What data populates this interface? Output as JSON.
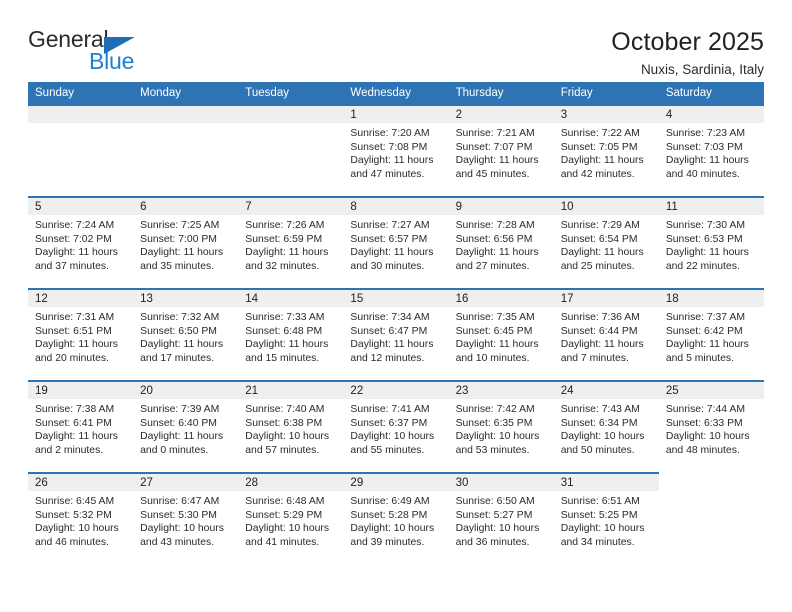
{
  "logo": {
    "word1": "General",
    "word2": "Blue",
    "triangle_color": "#1f6db5",
    "word2_color": "#1f7fd0"
  },
  "header": {
    "title": "October 2025",
    "subtitle": "Nuxis, Sardinia, Italy"
  },
  "theme": {
    "header_bg": "#2e74b5",
    "header_text": "#ffffff",
    "daynum_bg": "#efefef",
    "row_rule": "#2e74b5"
  },
  "calendar": {
    "weekday_headers": [
      "Sunday",
      "Monday",
      "Tuesday",
      "Wednesday",
      "Thursday",
      "Friday",
      "Saturday"
    ],
    "labels": {
      "sunrise": "Sunrise:",
      "sunset": "Sunset:",
      "daylight": "Daylight:"
    },
    "weeks": [
      [
        {
          "day": "",
          "empty": true,
          "band": true
        },
        {
          "day": "",
          "empty": true,
          "band": true
        },
        {
          "day": "",
          "empty": true,
          "band": true
        },
        {
          "day": "1",
          "sunrise": "Sunrise: 7:20 AM",
          "sunset": "Sunset: 7:08 PM",
          "daylight1": "Daylight: 11 hours",
          "daylight2": "and 47 minutes."
        },
        {
          "day": "2",
          "sunrise": "Sunrise: 7:21 AM",
          "sunset": "Sunset: 7:07 PM",
          "daylight1": "Daylight: 11 hours",
          "daylight2": "and 45 minutes."
        },
        {
          "day": "3",
          "sunrise": "Sunrise: 7:22 AM",
          "sunset": "Sunset: 7:05 PM",
          "daylight1": "Daylight: 11 hours",
          "daylight2": "and 42 minutes."
        },
        {
          "day": "4",
          "sunrise": "Sunrise: 7:23 AM",
          "sunset": "Sunset: 7:03 PM",
          "daylight1": "Daylight: 11 hours",
          "daylight2": "and 40 minutes."
        }
      ],
      [
        {
          "day": "5",
          "sunrise": "Sunrise: 7:24 AM",
          "sunset": "Sunset: 7:02 PM",
          "daylight1": "Daylight: 11 hours",
          "daylight2": "and 37 minutes."
        },
        {
          "day": "6",
          "sunrise": "Sunrise: 7:25 AM",
          "sunset": "Sunset: 7:00 PM",
          "daylight1": "Daylight: 11 hours",
          "daylight2": "and 35 minutes."
        },
        {
          "day": "7",
          "sunrise": "Sunrise: 7:26 AM",
          "sunset": "Sunset: 6:59 PM",
          "daylight1": "Daylight: 11 hours",
          "daylight2": "and 32 minutes."
        },
        {
          "day": "8",
          "sunrise": "Sunrise: 7:27 AM",
          "sunset": "Sunset: 6:57 PM",
          "daylight1": "Daylight: 11 hours",
          "daylight2": "and 30 minutes."
        },
        {
          "day": "9",
          "sunrise": "Sunrise: 7:28 AM",
          "sunset": "Sunset: 6:56 PM",
          "daylight1": "Daylight: 11 hours",
          "daylight2": "and 27 minutes."
        },
        {
          "day": "10",
          "sunrise": "Sunrise: 7:29 AM",
          "sunset": "Sunset: 6:54 PM",
          "daylight1": "Daylight: 11 hours",
          "daylight2": "and 25 minutes."
        },
        {
          "day": "11",
          "sunrise": "Sunrise: 7:30 AM",
          "sunset": "Sunset: 6:53 PM",
          "daylight1": "Daylight: 11 hours",
          "daylight2": "and 22 minutes."
        }
      ],
      [
        {
          "day": "12",
          "sunrise": "Sunrise: 7:31 AM",
          "sunset": "Sunset: 6:51 PM",
          "daylight1": "Daylight: 11 hours",
          "daylight2": "and 20 minutes."
        },
        {
          "day": "13",
          "sunrise": "Sunrise: 7:32 AM",
          "sunset": "Sunset: 6:50 PM",
          "daylight1": "Daylight: 11 hours",
          "daylight2": "and 17 minutes."
        },
        {
          "day": "14",
          "sunrise": "Sunrise: 7:33 AM",
          "sunset": "Sunset: 6:48 PM",
          "daylight1": "Daylight: 11 hours",
          "daylight2": "and 15 minutes."
        },
        {
          "day": "15",
          "sunrise": "Sunrise: 7:34 AM",
          "sunset": "Sunset: 6:47 PM",
          "daylight1": "Daylight: 11 hours",
          "daylight2": "and 12 minutes."
        },
        {
          "day": "16",
          "sunrise": "Sunrise: 7:35 AM",
          "sunset": "Sunset: 6:45 PM",
          "daylight1": "Daylight: 11 hours",
          "daylight2": "and 10 minutes."
        },
        {
          "day": "17",
          "sunrise": "Sunrise: 7:36 AM",
          "sunset": "Sunset: 6:44 PM",
          "daylight1": "Daylight: 11 hours",
          "daylight2": "and 7 minutes."
        },
        {
          "day": "18",
          "sunrise": "Sunrise: 7:37 AM",
          "sunset": "Sunset: 6:42 PM",
          "daylight1": "Daylight: 11 hours",
          "daylight2": "and 5 minutes."
        }
      ],
      [
        {
          "day": "19",
          "sunrise": "Sunrise: 7:38 AM",
          "sunset": "Sunset: 6:41 PM",
          "daylight1": "Daylight: 11 hours",
          "daylight2": "and 2 minutes."
        },
        {
          "day": "20",
          "sunrise": "Sunrise: 7:39 AM",
          "sunset": "Sunset: 6:40 PM",
          "daylight1": "Daylight: 11 hours",
          "daylight2": "and 0 minutes."
        },
        {
          "day": "21",
          "sunrise": "Sunrise: 7:40 AM",
          "sunset": "Sunset: 6:38 PM",
          "daylight1": "Daylight: 10 hours",
          "daylight2": "and 57 minutes."
        },
        {
          "day": "22",
          "sunrise": "Sunrise: 7:41 AM",
          "sunset": "Sunset: 6:37 PM",
          "daylight1": "Daylight: 10 hours",
          "daylight2": "and 55 minutes."
        },
        {
          "day": "23",
          "sunrise": "Sunrise: 7:42 AM",
          "sunset": "Sunset: 6:35 PM",
          "daylight1": "Daylight: 10 hours",
          "daylight2": "and 53 minutes."
        },
        {
          "day": "24",
          "sunrise": "Sunrise: 7:43 AM",
          "sunset": "Sunset: 6:34 PM",
          "daylight1": "Daylight: 10 hours",
          "daylight2": "and 50 minutes."
        },
        {
          "day": "25",
          "sunrise": "Sunrise: 7:44 AM",
          "sunset": "Sunset: 6:33 PM",
          "daylight1": "Daylight: 10 hours",
          "daylight2": "and 48 minutes."
        }
      ],
      [
        {
          "day": "26",
          "sunrise": "Sunrise: 6:45 AM",
          "sunset": "Sunset: 5:32 PM",
          "daylight1": "Daylight: 10 hours",
          "daylight2": "and 46 minutes."
        },
        {
          "day": "27",
          "sunrise": "Sunrise: 6:47 AM",
          "sunset": "Sunset: 5:30 PM",
          "daylight1": "Daylight: 10 hours",
          "daylight2": "and 43 minutes."
        },
        {
          "day": "28",
          "sunrise": "Sunrise: 6:48 AM",
          "sunset": "Sunset: 5:29 PM",
          "daylight1": "Daylight: 10 hours",
          "daylight2": "and 41 minutes."
        },
        {
          "day": "29",
          "sunrise": "Sunrise: 6:49 AM",
          "sunset": "Sunset: 5:28 PM",
          "daylight1": "Daylight: 10 hours",
          "daylight2": "and 39 minutes."
        },
        {
          "day": "30",
          "sunrise": "Sunrise: 6:50 AM",
          "sunset": "Sunset: 5:27 PM",
          "daylight1": "Daylight: 10 hours",
          "daylight2": "and 36 minutes."
        },
        {
          "day": "31",
          "sunrise": "Sunrise: 6:51 AM",
          "sunset": "Sunset: 5:25 PM",
          "daylight1": "Daylight: 10 hours",
          "daylight2": "and 34 minutes."
        },
        {
          "day": "",
          "empty": true,
          "band": false
        }
      ]
    ]
  }
}
